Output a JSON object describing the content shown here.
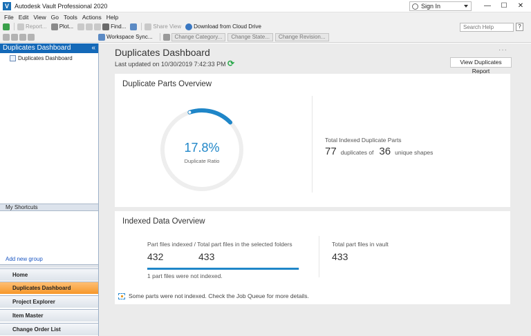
{
  "window": {
    "title": "Autodesk Vault Professional 2020",
    "app_icon_letter": "V",
    "signin_label": "Sign In",
    "minimize": "—",
    "maximize": "☐",
    "close": "✕"
  },
  "menu": [
    "File",
    "Edit",
    "View",
    "Go",
    "Tools",
    "Actions",
    "Help"
  ],
  "toolbar1": {
    "report": "Report...",
    "plot": "Plot...",
    "find": "Find...",
    "share_view": "Share View",
    "download_cloud": "Download from Cloud Drive",
    "search_placeholder": "Search Help",
    "help": "?"
  },
  "toolbar2": {
    "workspace_sync": "Workspace Sync...",
    "change_category": "Change Category...",
    "change_state": "Change State...",
    "change_revision": "Change Revision..."
  },
  "left_panel": {
    "header": "Duplicates Dashboard",
    "collapse": "«",
    "tree_item": "Duplicates Dashboard",
    "shortcuts_header": "My Shortcuts",
    "add_group": "Add new group",
    "nav": [
      {
        "label": "Home",
        "color": "#4a7cc2"
      },
      {
        "label": "Duplicates Dashboard",
        "color": "#c05a1a"
      },
      {
        "label": "Project Explorer",
        "color": "#3e8dd0"
      },
      {
        "label": "Item Master",
        "color": "#5c7fa8"
      },
      {
        "label": "Change Order List",
        "color": "#7a8ea8"
      }
    ]
  },
  "main": {
    "title": "Duplicates Dashboard",
    "last_updated": "Last updated on 10/30/2019 7:42:33 PM",
    "refresh_icon": "⟳",
    "more_icon": "···",
    "view_report_button": "View Duplicates Report",
    "overview": {
      "title": "Duplicate Parts Overview",
      "ratio_text": "17.8%",
      "ratio_value": 0.178,
      "ratio_label": "Duplicate Ratio",
      "total_label": "Total Indexed Duplicate Parts",
      "duplicates_count": "77",
      "duplicates_of": "duplicates of",
      "unique_count": "36",
      "unique_shapes": "unique shapes"
    },
    "indexed": {
      "title": "Indexed Data Overview",
      "files_label": "Part files indexed / Total part files in the selected folders",
      "indexed_count": "432",
      "total_count": "433",
      "progress_value": 0.9977,
      "not_indexed_note": "1 part files were not indexed.",
      "vault_label": "Total part files in vault",
      "vault_count": "433",
      "warning": "Some parts were not indexed. Check the Job Queue for more details."
    }
  },
  "colors": {
    "accent_blue": "#1f86c8",
    "header_blue": "#1469b8",
    "active_nav": "#f6972a",
    "refresh_green": "#29a84a"
  }
}
